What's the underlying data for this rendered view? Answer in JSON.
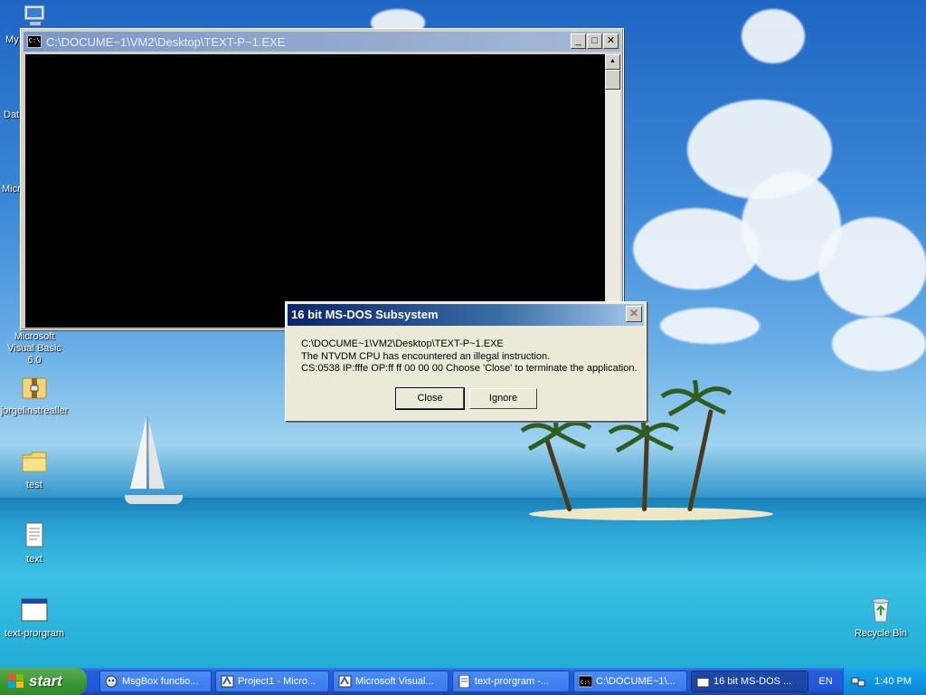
{
  "desktop": {
    "icons": [
      {
        "label": "Microsoft Visual Basic 6.0"
      },
      {
        "label": "jorgelinstrealler"
      },
      {
        "label": "test"
      },
      {
        "label": "text"
      },
      {
        "label": "text-prorgram"
      },
      {
        "label": "Recycle Bin"
      }
    ],
    "clipped_labels": [
      "My",
      "Dat",
      "Micro"
    ]
  },
  "console": {
    "title": "C:\\DOCUME~1\\VM2\\Desktop\\TEXT-P~1.EXE",
    "icon_text": "C:\\",
    "minimize": "_",
    "maximize": "□",
    "close": "✕"
  },
  "dialog": {
    "title": "16 bit MS-DOS Subsystem",
    "close": "✕",
    "lines": [
      "C:\\DOCUME~1\\VM2\\Desktop\\TEXT-P~1.EXE",
      "The NTVDM CPU has encountered an illegal instruction.",
      "CS:0538 IP:fffe OP:ff ff 00 00 00 Choose 'Close' to terminate the application."
    ],
    "buttons": {
      "close": "Close",
      "ignore": "Ignore"
    }
  },
  "taskbar": {
    "start": "start",
    "tasks": [
      {
        "label": "MsgBox functio...",
        "icon": "vb-help-icon"
      },
      {
        "label": "Project1 - Micro...",
        "icon": "vb-project-icon"
      },
      {
        "label": "Microsoft Visual...",
        "icon": "vb-ide-icon"
      },
      {
        "label": "text-prorgram -...",
        "icon": "notepad-icon"
      },
      {
        "label": "C:\\DOCUME~1\\...",
        "icon": "cmd-icon"
      },
      {
        "label": "16 bit MS-DOS ...",
        "icon": "window-icon"
      }
    ],
    "language": "EN",
    "clock": "1:40 PM"
  }
}
